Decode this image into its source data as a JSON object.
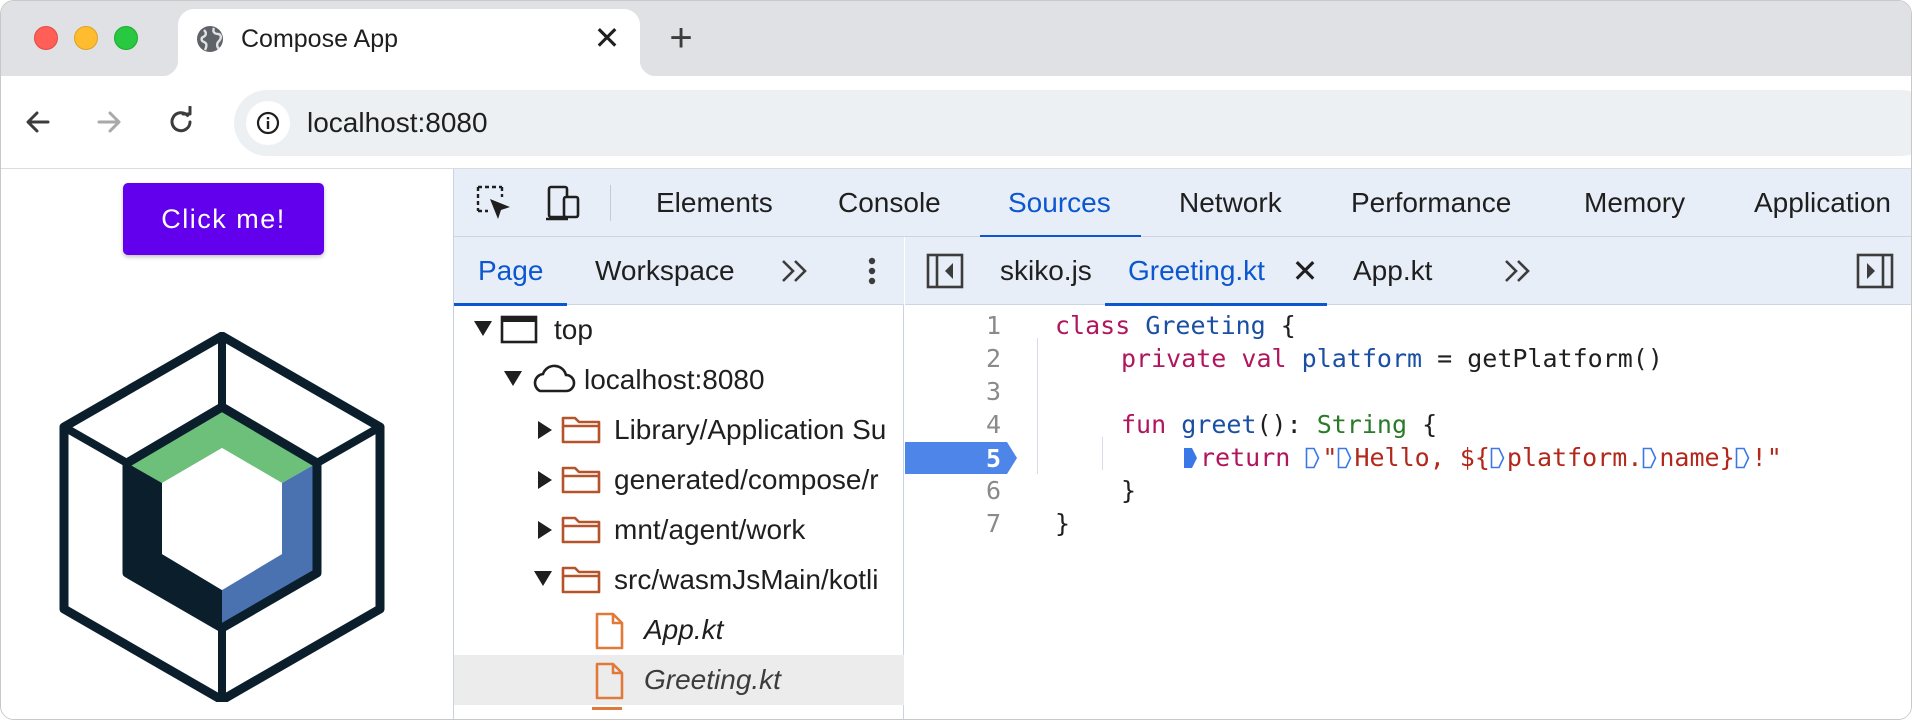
{
  "browser": {
    "tab_title": "Compose App",
    "tab_close": "✕",
    "new_tab": "+",
    "url": "localhost:8080"
  },
  "page": {
    "button_label": "Click me!",
    "logo": "compose-multiplatform-logo",
    "colors": {
      "button": "#6200ee",
      "logo_green": "#6dc07a",
      "logo_blue": "#4a72b0",
      "logo_dark": "#0b1e2b"
    }
  },
  "devtools": {
    "main_tabs": [
      "Elements",
      "Console",
      "Sources",
      "Network",
      "Performance",
      "Memory",
      "Application"
    ],
    "active_main_tab": "Sources",
    "navigator": {
      "tabs": [
        "Page",
        "Workspace"
      ],
      "active_tab": "Page",
      "tree": [
        {
          "label": "top",
          "icon": "frame-icon",
          "expanded": true
        },
        {
          "label": "localhost:8080",
          "icon": "cloud-icon",
          "expanded": true
        },
        {
          "label": "Library/Application Su",
          "icon": "folder-icon",
          "expanded": false
        },
        {
          "label": "generated/compose/r",
          "icon": "folder-icon",
          "expanded": false
        },
        {
          "label": "mnt/agent/work",
          "icon": "folder-icon",
          "expanded": false
        },
        {
          "label": "src/wasmJsMain/kotli",
          "icon": "folder-icon",
          "expanded": true
        },
        {
          "label": "App.kt",
          "icon": "file-icon"
        },
        {
          "label": "Greeting.kt",
          "icon": "file-icon",
          "selected": true
        }
      ]
    },
    "editor": {
      "tabs": [
        "skiko.js",
        "Greeting.kt",
        "App.kt"
      ],
      "active_tab": "Greeting.kt",
      "close": "✕",
      "breakpoint_line": "5",
      "line_numbers": [
        "1",
        "2",
        "3",
        "4",
        "5",
        "6",
        "7"
      ],
      "code": {
        "l1": {
          "kw": "class",
          "name": "Greeting",
          "rest": " {"
        },
        "l2": {
          "kw": "private val",
          "name": "platform",
          "rest": " = getPlatform()"
        },
        "l4": {
          "kw": "fun",
          "name": "greet",
          "rest1": "(): ",
          "type": "String",
          "rest2": " {"
        },
        "l5": {
          "kw": "return",
          "q": "\"",
          "s1": "Hello, ${",
          "s2": "platform.",
          "s3": "name}",
          "s4": "!\""
        },
        "l6": "}",
        "l7": "}"
      }
    }
  }
}
